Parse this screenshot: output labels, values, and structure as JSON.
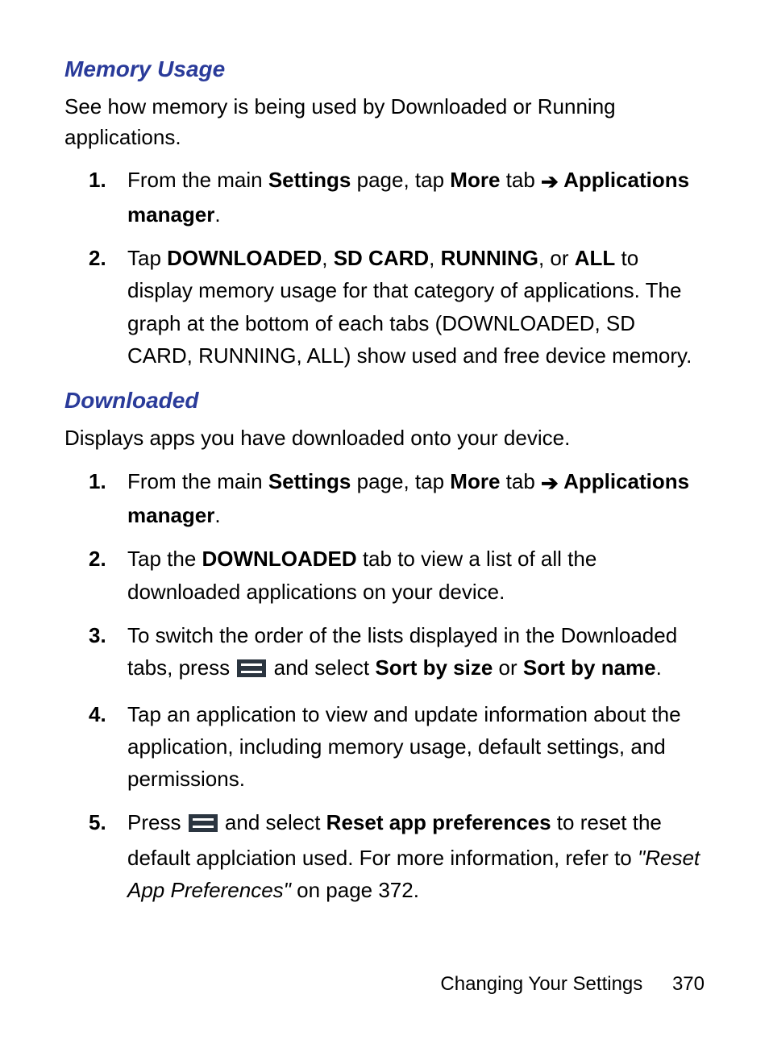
{
  "section1": {
    "heading": "Memory Usage",
    "lead": "See how memory is being used by Downloaded or Running applications.",
    "steps": {
      "s1": {
        "num": "1.",
        "t1": "From the main ",
        "b1": "Settings",
        "t2": " page, tap ",
        "b2": "More",
        "t3": " tab ",
        "arrow": "➔",
        "b3": " Applications manager",
        "t4": "."
      },
      "s2": {
        "num": "2.",
        "t1": "Tap ",
        "b1": "DOWNLOADED",
        "c1": ", ",
        "b2": "SD CARD",
        "c2": ", ",
        "b3": "RUNNING",
        "c3": ", or ",
        "b4": "ALL",
        "t2": " to display memory usage for that category of applications. The graph at the bottom of each tabs (DOWNLOADED, SD CARD, RUNNING, ALL) show used and free device memory."
      }
    }
  },
  "section2": {
    "heading": "Downloaded",
    "lead": "Displays apps you have downloaded onto your device.",
    "steps": {
      "s1": {
        "num": "1.",
        "t1": "From the main ",
        "b1": "Settings",
        "t2": " page, tap ",
        "b2": "More",
        "t3": " tab ",
        "arrow": "➔",
        "b3": " Applications manager",
        "t4": "."
      },
      "s2": {
        "num": "2.",
        "t1": "Tap the ",
        "b1": "DOWNLOADED",
        "t2": " tab to view a list of all the downloaded applications on your device."
      },
      "s3": {
        "num": "3.",
        "t1": "To switch the order of the lists displayed in the Downloaded tabs, press ",
        "t2": " and select ",
        "b1": "Sort by size",
        "t3": " or ",
        "b2": "Sort by name",
        "t4": "."
      },
      "s4": {
        "num": "4.",
        "t1": "Tap an application to view and update information about the application, including memory usage, default settings, and permissions."
      },
      "s5": {
        "num": "5.",
        "t1": "Press ",
        "t2": " and select ",
        "b1": "Reset app preferences",
        "t3": " to reset the default applciation used. For more information, refer to ",
        "i1": "\"Reset App Preferences\"",
        "t4": "  on page 372."
      }
    }
  },
  "footer": {
    "chapter": "Changing Your Settings",
    "page": "370"
  }
}
